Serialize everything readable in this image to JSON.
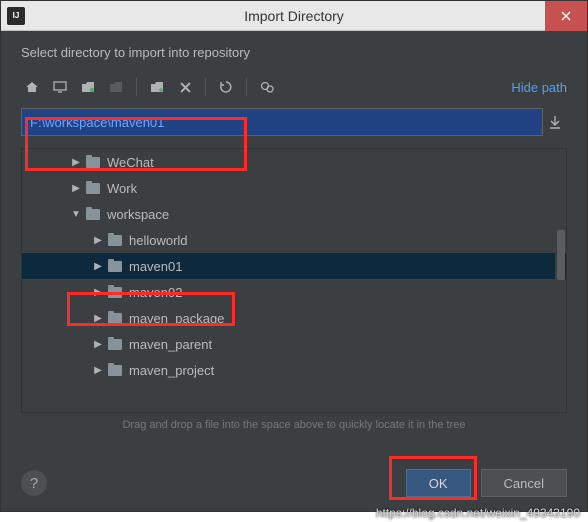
{
  "window": {
    "title": "Import Directory"
  },
  "instruction": "Select directory to import into repository",
  "toolbar": {
    "hide_path": "Hide path"
  },
  "path": {
    "value": "F:\\workspace\\maven01"
  },
  "tree": {
    "items": [
      {
        "label": "WeChat",
        "depth": 1,
        "expanded": false,
        "selected": false
      },
      {
        "label": "Work",
        "depth": 1,
        "expanded": false,
        "selected": false
      },
      {
        "label": "workspace",
        "depth": 1,
        "expanded": true,
        "selected": false
      },
      {
        "label": "helloworld",
        "depth": 2,
        "expanded": false,
        "selected": false
      },
      {
        "label": "maven01",
        "depth": 2,
        "expanded": false,
        "selected": true
      },
      {
        "label": "maven02",
        "depth": 2,
        "expanded": false,
        "selected": false
      },
      {
        "label": "maven_package",
        "depth": 2,
        "expanded": false,
        "selected": false
      },
      {
        "label": "maven_parent",
        "depth": 2,
        "expanded": false,
        "selected": false
      },
      {
        "label": "maven_project",
        "depth": 2,
        "expanded": false,
        "selected": false
      }
    ]
  },
  "hint": "Drag and drop a file into the space above to quickly locate it in the tree",
  "buttons": {
    "ok": "OK",
    "cancel": "Cancel"
  },
  "watermark": "https://blog.csdn.net/weixin_49343190"
}
